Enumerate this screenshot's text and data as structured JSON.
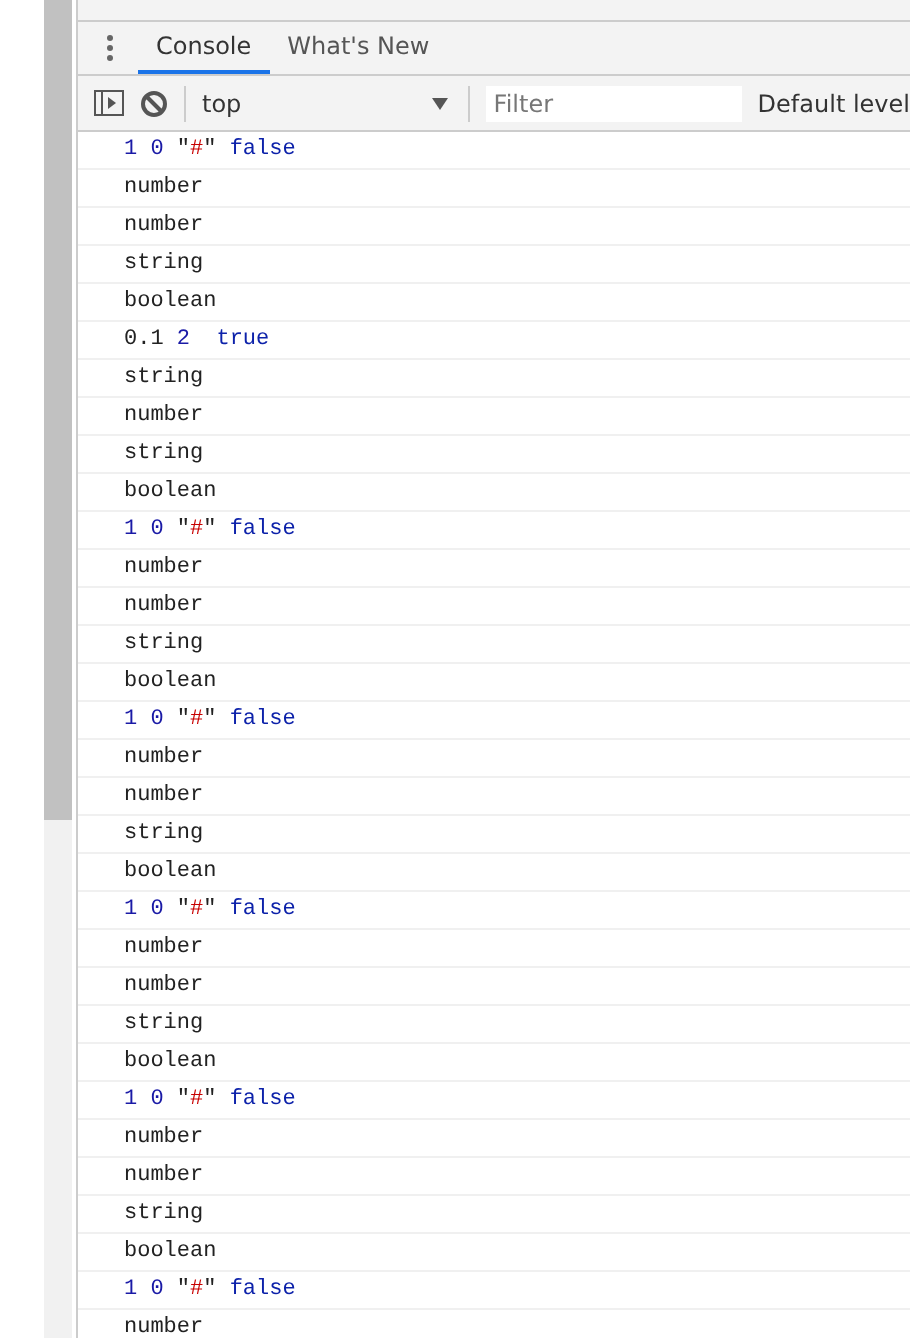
{
  "tabs": [
    {
      "label": "Console",
      "selected": true
    },
    {
      "label": "What's New",
      "selected": false
    }
  ],
  "toolbar": {
    "context": "top",
    "filter": {
      "placeholder": "Filter"
    },
    "levels": "Default level"
  },
  "messages": [
    [
      {
        "kind": "number",
        "text": "1 0 "
      },
      {
        "kind": "text",
        "text": "\""
      },
      {
        "kind": "string",
        "text": "#"
      },
      {
        "kind": "text",
        "text": "\" "
      },
      {
        "kind": "boolean",
        "text": "false"
      }
    ],
    [
      {
        "kind": "text",
        "text": "number"
      }
    ],
    [
      {
        "kind": "text",
        "text": "number"
      }
    ],
    [
      {
        "kind": "text",
        "text": "string"
      }
    ],
    [
      {
        "kind": "text",
        "text": "boolean"
      }
    ],
    [
      {
        "kind": "text",
        "text": "0.1 "
      },
      {
        "kind": "number",
        "text": "2  "
      },
      {
        "kind": "boolean",
        "text": "true"
      }
    ],
    [
      {
        "kind": "text",
        "text": "string"
      }
    ],
    [
      {
        "kind": "text",
        "text": "number"
      }
    ],
    [
      {
        "kind": "text",
        "text": "string"
      }
    ],
    [
      {
        "kind": "text",
        "text": "boolean"
      }
    ],
    [
      {
        "kind": "number",
        "text": "1 0 "
      },
      {
        "kind": "text",
        "text": "\""
      },
      {
        "kind": "string",
        "text": "#"
      },
      {
        "kind": "text",
        "text": "\" "
      },
      {
        "kind": "boolean",
        "text": "false"
      }
    ],
    [
      {
        "kind": "text",
        "text": "number"
      }
    ],
    [
      {
        "kind": "text",
        "text": "number"
      }
    ],
    [
      {
        "kind": "text",
        "text": "string"
      }
    ],
    [
      {
        "kind": "text",
        "text": "boolean"
      }
    ],
    [
      {
        "kind": "number",
        "text": "1 0 "
      },
      {
        "kind": "text",
        "text": "\""
      },
      {
        "kind": "string",
        "text": "#"
      },
      {
        "kind": "text",
        "text": "\" "
      },
      {
        "kind": "boolean",
        "text": "false"
      }
    ],
    [
      {
        "kind": "text",
        "text": "number"
      }
    ],
    [
      {
        "kind": "text",
        "text": "number"
      }
    ],
    [
      {
        "kind": "text",
        "text": "string"
      }
    ],
    [
      {
        "kind": "text",
        "text": "boolean"
      }
    ],
    [
      {
        "kind": "number",
        "text": "1 0 "
      },
      {
        "kind": "text",
        "text": "\""
      },
      {
        "kind": "string",
        "text": "#"
      },
      {
        "kind": "text",
        "text": "\" "
      },
      {
        "kind": "boolean",
        "text": "false"
      }
    ],
    [
      {
        "kind": "text",
        "text": "number"
      }
    ],
    [
      {
        "kind": "text",
        "text": "number"
      }
    ],
    [
      {
        "kind": "text",
        "text": "string"
      }
    ],
    [
      {
        "kind": "text",
        "text": "boolean"
      }
    ],
    [
      {
        "kind": "number",
        "text": "1 0 "
      },
      {
        "kind": "text",
        "text": "\""
      },
      {
        "kind": "string",
        "text": "#"
      },
      {
        "kind": "text",
        "text": "\" "
      },
      {
        "kind": "boolean",
        "text": "false"
      }
    ],
    [
      {
        "kind": "text",
        "text": "number"
      }
    ],
    [
      {
        "kind": "text",
        "text": "number"
      }
    ],
    [
      {
        "kind": "text",
        "text": "string"
      }
    ],
    [
      {
        "kind": "text",
        "text": "boolean"
      }
    ],
    [
      {
        "kind": "number",
        "text": "1 0 "
      },
      {
        "kind": "text",
        "text": "\""
      },
      {
        "kind": "string",
        "text": "#"
      },
      {
        "kind": "text",
        "text": "\" "
      },
      {
        "kind": "boolean",
        "text": "false"
      }
    ],
    [
      {
        "kind": "text",
        "text": "number"
      }
    ]
  ]
}
